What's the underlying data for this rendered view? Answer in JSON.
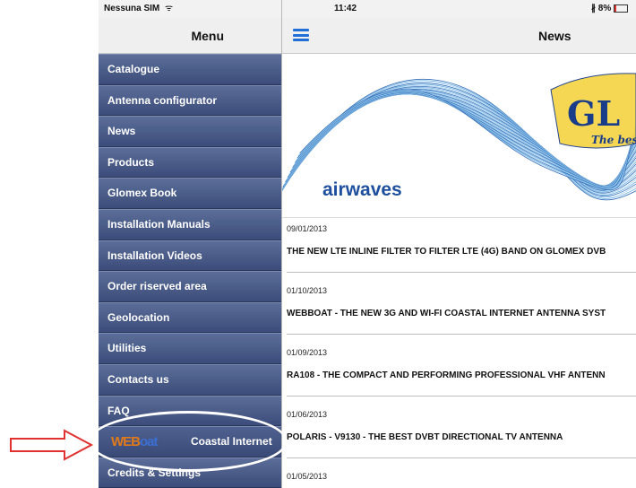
{
  "status": {
    "carrier": "Nessuna SIM",
    "wifi_icon": "ᯤ",
    "time": "11:42",
    "bluetooth_icon": "∦",
    "battery": "8%"
  },
  "sidebar": {
    "title": "Menu",
    "items": [
      {
        "label": "Catalogue"
      },
      {
        "label": "Antenna configurator"
      },
      {
        "label": "News"
      },
      {
        "label": "Products"
      },
      {
        "label": "Glomex Book"
      },
      {
        "label": "Installation Manuals"
      },
      {
        "label": "Installation Videos"
      },
      {
        "label": "Order riserved area"
      },
      {
        "label": "Geolocation"
      },
      {
        "label": "Utilities"
      },
      {
        "label": "Contacts us"
      },
      {
        "label": "FAQ"
      }
    ],
    "webboat": {
      "logo_part1": "WEB",
      "logo_part2": "oat",
      "label": "Coastal Internet"
    },
    "last_item": "Credits & Settings"
  },
  "main": {
    "title": "News",
    "banner": {
      "logo_text": "GL",
      "tagline": "The best",
      "airwaves_part1": "air",
      "airwaves_part2": "waves"
    },
    "news": [
      {
        "date": "09/01/2013",
        "headline": "THE NEW LTE INLINE FILTER TO FILTER LTE (4G) BAND ON GLOMEX DVB"
      },
      {
        "date": "01/10/2013",
        "headline": "WEBBOAT - THE NEW 3G AND WI-FI COASTAL INTERNET ANTENNA SYST"
      },
      {
        "date": "01/09/2013",
        "headline": "RA108 - THE COMPACT AND PERFORMING PROFESSIONAL VHF ANTENN"
      },
      {
        "date": "01/06/2013",
        "headline": "POLARIS - V9130 - THE BEST DVBT DIRECTIONAL TV ANTENNA"
      },
      {
        "date": "01/05/2013",
        "headline": ""
      }
    ]
  },
  "colors": {
    "sidebar_bg": "#3d4f7e",
    "highlight": "#e03030",
    "accent_blue": "#1f6fd6"
  }
}
